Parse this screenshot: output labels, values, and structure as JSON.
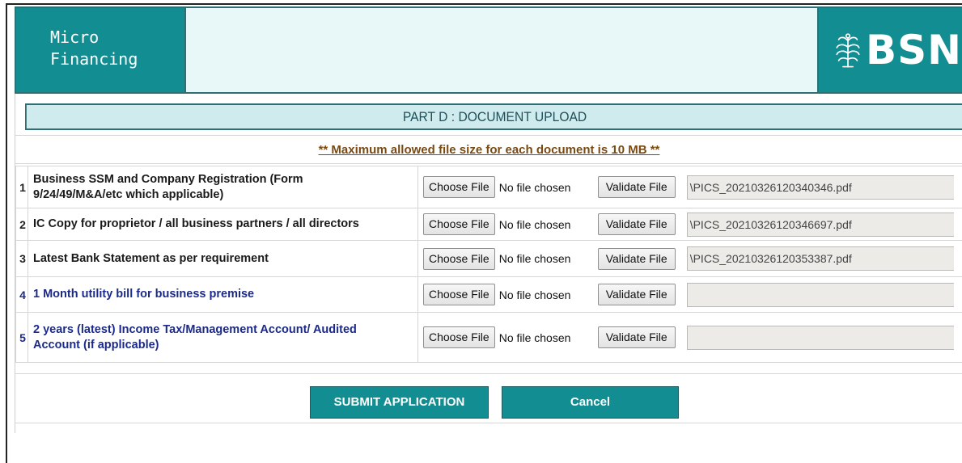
{
  "header": {
    "brand_line1": "Micro",
    "brand_line2": "Financing",
    "bank_name": "BSN",
    "logo_icon": "tree-emblem-icon"
  },
  "part_title": "PART D : DOCUMENT UPLOAD",
  "notice": "** Maximum allowed file size for each document is 10 MB **",
  "documents": [
    {
      "num": "1",
      "label_line1": "Business SSM and Company Registration (Form",
      "label_line2": "9/24/49/M&A/etc which applicable)",
      "choose_label": "Choose File",
      "file_status": "No file chosen",
      "validate_label": "Validate File",
      "path": "\\PICS_20210326120340346.pdf"
    },
    {
      "num": "2",
      "label_line1": "IC Copy for proprietor / all business partners / all directors",
      "label_line2": "",
      "choose_label": "Choose File",
      "file_status": "No file chosen",
      "validate_label": "Validate File",
      "path": "\\PICS_20210326120346697.pdf"
    },
    {
      "num": "3",
      "label_line1": "Latest Bank Statement as per requirement",
      "label_line2": "",
      "choose_label": "Choose File",
      "file_status": "No file chosen",
      "validate_label": "Validate File",
      "path": "\\PICS_20210326120353387.pdf"
    },
    {
      "num": "4",
      "label_line1": "1 Month utility bill for business premise",
      "label_line2": "",
      "choose_label": "Choose File",
      "file_status": "No file chosen",
      "validate_label": "Validate File",
      "path": ""
    },
    {
      "num": "5",
      "label_line1": "2 years (latest) Income Tax/Management Account/ Audited",
      "label_line2": "Account (if applicable)",
      "choose_label": "Choose File",
      "file_status": "No file chosen",
      "validate_label": "Validate File",
      "path": ""
    }
  ],
  "actions": {
    "submit_label": "SUBMIT APPLICATION",
    "cancel_label": "Cancel"
  },
  "colors": {
    "brand_teal": "#128d92",
    "title_bg": "#d0ebed",
    "notice_text": "#7a4a12",
    "optional_label": "#1b2a8a"
  }
}
